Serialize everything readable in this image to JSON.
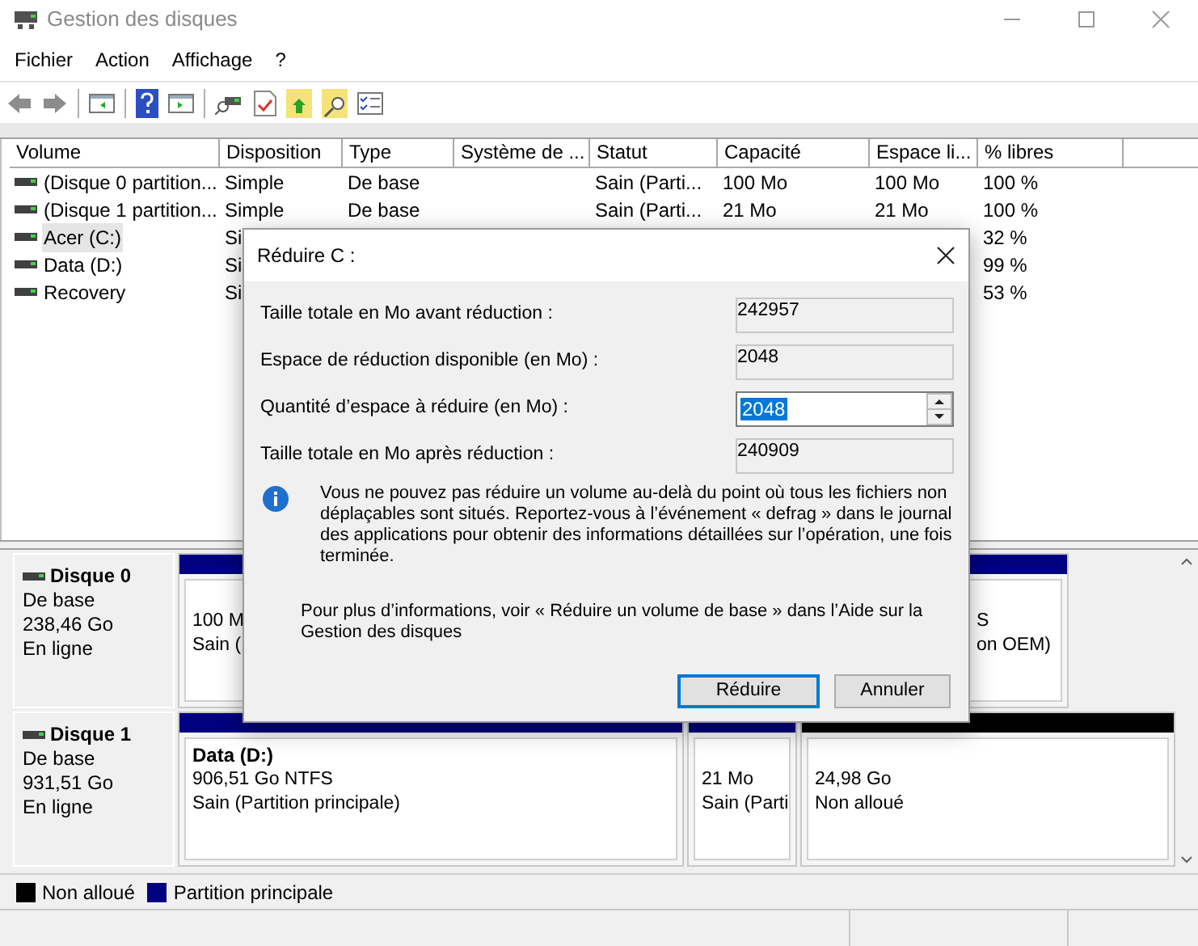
{
  "window": {
    "title": "Gestion des disques"
  },
  "menu": [
    "Fichier",
    "Action",
    "Affichage",
    "?"
  ],
  "table": {
    "columns": [
      "Volume",
      "Disposition",
      "Type",
      "Système de ...",
      "Statut",
      "Capacité",
      "Espace li...",
      "% libres"
    ],
    "rows": [
      {
        "volume": "(Disque 0 partition...",
        "disposition": "Simple",
        "type": "De base",
        "status": "Sain (Parti...",
        "capacity": "100 Mo",
        "free": "100 Mo",
        "percent_free": "100 %",
        "selected": false
      },
      {
        "volume": "(Disque 1 partition...",
        "disposition": "Simple",
        "type": "De base",
        "status": "Sain (Parti...",
        "capacity": "21 Mo",
        "free": "21 Mo",
        "percent_free": "100 %",
        "selected": false
      },
      {
        "volume": "Acer (C:)",
        "disposition": "Si",
        "percent_free": "32 %",
        "selected": true
      },
      {
        "volume": "Data (D:)",
        "disposition": "Si",
        "percent_free": "99 %",
        "selected": false
      },
      {
        "volume": "Recovery",
        "disposition": "Si",
        "percent_free": "53 %",
        "selected": false
      }
    ]
  },
  "disks": [
    {
      "name": "Disque 0",
      "type": "De base",
      "size": "238,46 Go",
      "state": "En ligne",
      "partitions": [
        {
          "kind": "primary",
          "lines": [
            "100 M",
            "Sain ("
          ]
        },
        {
          "kind": "primary",
          "lines": [
            "S",
            "on OEM)"
          ]
        }
      ]
    },
    {
      "name": "Disque 1",
      "type": "De base",
      "size": "931,51 Go",
      "state": "En ligne",
      "partitions": [
        {
          "kind": "primary",
          "title": "Data  (D:)",
          "lines": [
            "906,51 Go NTFS",
            "Sain (Partition principale)"
          ]
        },
        {
          "kind": "primary",
          "lines": [
            "21 Mo",
            "Sain (Parti"
          ]
        },
        {
          "kind": "unallocated",
          "lines": [
            "24,98 Go",
            "Non alloué"
          ]
        }
      ]
    }
  ],
  "legend": [
    {
      "label": "Non alloué",
      "color": "#000000"
    },
    {
      "label": "Partition principale",
      "color": "#000080"
    }
  ],
  "dialog": {
    "title": "Réduire C :",
    "fields": [
      {
        "label": "Taille totale en Mo avant réduction :",
        "value": "242957",
        "kind": "readonly"
      },
      {
        "label": "Espace de réduction disponible (en Mo) :",
        "value": "2048",
        "kind": "readonly"
      },
      {
        "label": "Quantité d’espace à réduire (en Mo) :",
        "value": "2048",
        "kind": "spin"
      },
      {
        "label": "Taille totale en Mo après réduction :",
        "value": "240909",
        "kind": "readonly"
      }
    ],
    "info": "Vous ne pouvez pas réduire un volume au-delà du point où tous les fichiers non déplaçables sont situés. Reportez-vous à l’événement « defrag » dans le journal des applications pour obtenir des informations détaillées sur l’opération, une fois terminée.",
    "help": "Pour plus d’informations, voir « Réduire un volume de base » dans l’Aide sur la Gestion des disques",
    "buttons": [
      {
        "label": "Réduire",
        "default": true
      },
      {
        "label": "Annuler",
        "default": false
      }
    ]
  }
}
